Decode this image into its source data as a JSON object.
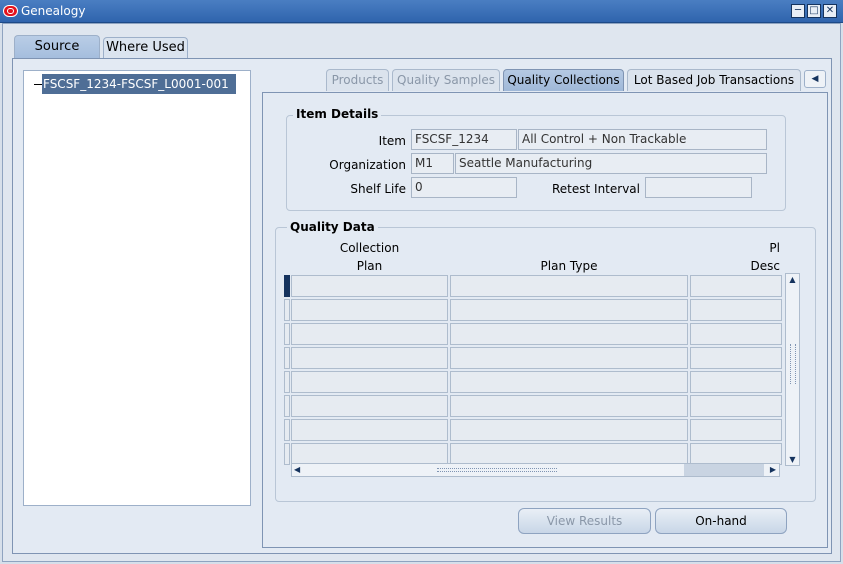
{
  "window": {
    "title": "Genealogy"
  },
  "main_tabs": [
    {
      "label": "Source",
      "active": true
    },
    {
      "label": "Where Used",
      "active": false
    }
  ],
  "tree": {
    "node_label": "FSCSF_1234-FSCSF_L0001-001"
  },
  "sub_tabs": [
    {
      "label": "Products",
      "state": "disabled"
    },
    {
      "label": "Quality Samples",
      "state": "disabled"
    },
    {
      "label": "Quality Collections",
      "state": "active"
    },
    {
      "label": "Lot Based Job Transactions",
      "state": "enabled"
    }
  ],
  "item_details": {
    "title": "Item Details",
    "item_label": "Item",
    "item_value": "FSCSF_1234",
    "item_desc": "All Control + Non Trackable",
    "org_label": "Organization",
    "org_code": "M1",
    "org_name": "Seattle Manufacturing",
    "shelf_label": "Shelf Life",
    "shelf_value": "0",
    "retest_label": "Retest Interval",
    "retest_value": ""
  },
  "quality_data": {
    "title": "Quality Data",
    "col1_line1": "Collection",
    "col1_line2": "Plan",
    "col2": "Plan Type",
    "col3_line1": "Pl",
    "col3_line2": "Desc",
    "row_count": 8
  },
  "buttons": {
    "view_results": "View Results",
    "onhand": "On-hand"
  }
}
